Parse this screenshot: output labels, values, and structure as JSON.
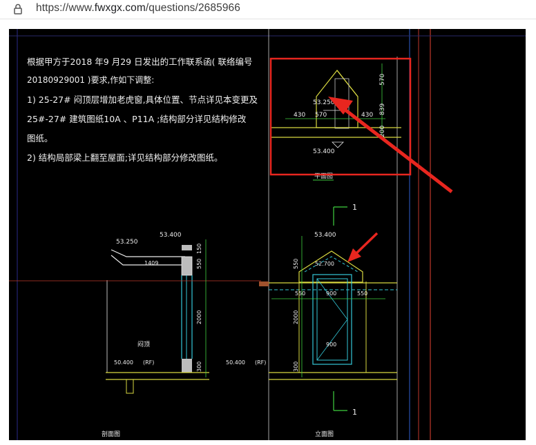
{
  "browser": {
    "url_prefix": "https://www.",
    "url_host": "fwxgx.com",
    "url_path": "/questions/2685966"
  },
  "drawing": {
    "notes": [
      "根据甲方于2018   年9 月29  日发出的工作联系函( 联络编号",
      "20180929001          )要求,作如下调整:",
      "1)  25-27#     闷顶层增加老虎窗,具体位置、节点详见本变更及",
      "25#-27#      建筑图纸10A    、P11A   ;结构部分详见结构修改",
      "图纸。",
      "2)  结构局部梁上翻至屋面;详见结构部分修改图纸。"
    ],
    "plan": {
      "elev_upper": "53.250",
      "elev_lower": "53.400",
      "dim_430_left": "430",
      "dim_570": "570",
      "dim_430_right": "430",
      "dim_570_v": "570",
      "dim_839": "839",
      "dim_200": "200",
      "title": "平面图"
    },
    "section_mark_top": "1",
    "section_mark_bottom": "1",
    "section": {
      "elev_5325": "53.250",
      "elev_5340": "53.400",
      "dim_1409": "1409",
      "dim_150": "150",
      "dim_550": "550",
      "dim_2000": "2000",
      "dim_300": "300",
      "label_attic": "闷顶",
      "level_left": "50.400",
      "rf_left": "(RF)",
      "level_right": "50.400",
      "rf_right": "(RF)",
      "title": "剖面图"
    },
    "elevation": {
      "elev_top": "53.400",
      "elev_inner": "52.700",
      "dim_550_v": "550",
      "dim_550_left": "550",
      "dim_900_top": "900",
      "dim_550_right": "550",
      "dim_2000": "2000",
      "dim_900_bottom": "900",
      "dim_300": "300",
      "title": "立面图"
    }
  },
  "colors": {
    "highlight_box": "#e8261f",
    "arrow": "#e8261f",
    "cad_yellow": "#d8d840",
    "cad_green": "#3fd13f",
    "cad_cyan": "#34c8d8",
    "cad_white": "#ececec",
    "cad_red": "#c0392b",
    "cad_blue": "#3060d0"
  },
  "icons": {
    "lock": "lock-icon"
  }
}
